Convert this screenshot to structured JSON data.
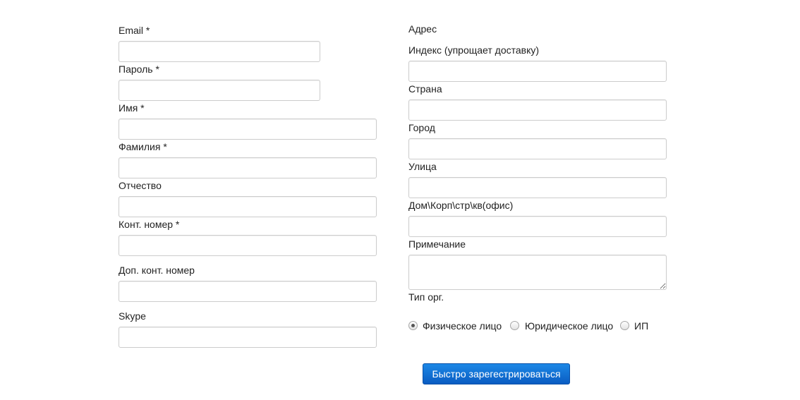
{
  "left_column": {
    "email_label": "Email *",
    "password_label": "Пароль *",
    "first_name_label": "Имя *",
    "last_name_label": "Фамилия *",
    "patronymic_label": "Отчество",
    "phone_label": "Конт. номер *",
    "extra_phone_label": "Доп. конт. номер",
    "skype_label": "Skype"
  },
  "right_column": {
    "address_heading": "Адрес",
    "zip_label": "Индекс (упрощает доставку)",
    "country_label": "Страна",
    "city_label": "Город",
    "street_label": "Улица",
    "building_label": "Дом\\Корп\\стр\\кв(офис)",
    "note_label": "Примечание",
    "org_type_label": "Тип орг.",
    "org_type_options": [
      {
        "label": "Физическое лицо",
        "checked": true
      },
      {
        "label": "Юридическое лицо",
        "checked": false
      },
      {
        "label": "ИП",
        "checked": false
      }
    ]
  },
  "submit_button_label": "Быстро зарегестрироваться",
  "colors": {
    "button_top": "#1c88e6",
    "button_bottom": "#0a5cc2",
    "input_border": "#cccccc",
    "text": "#222222"
  }
}
